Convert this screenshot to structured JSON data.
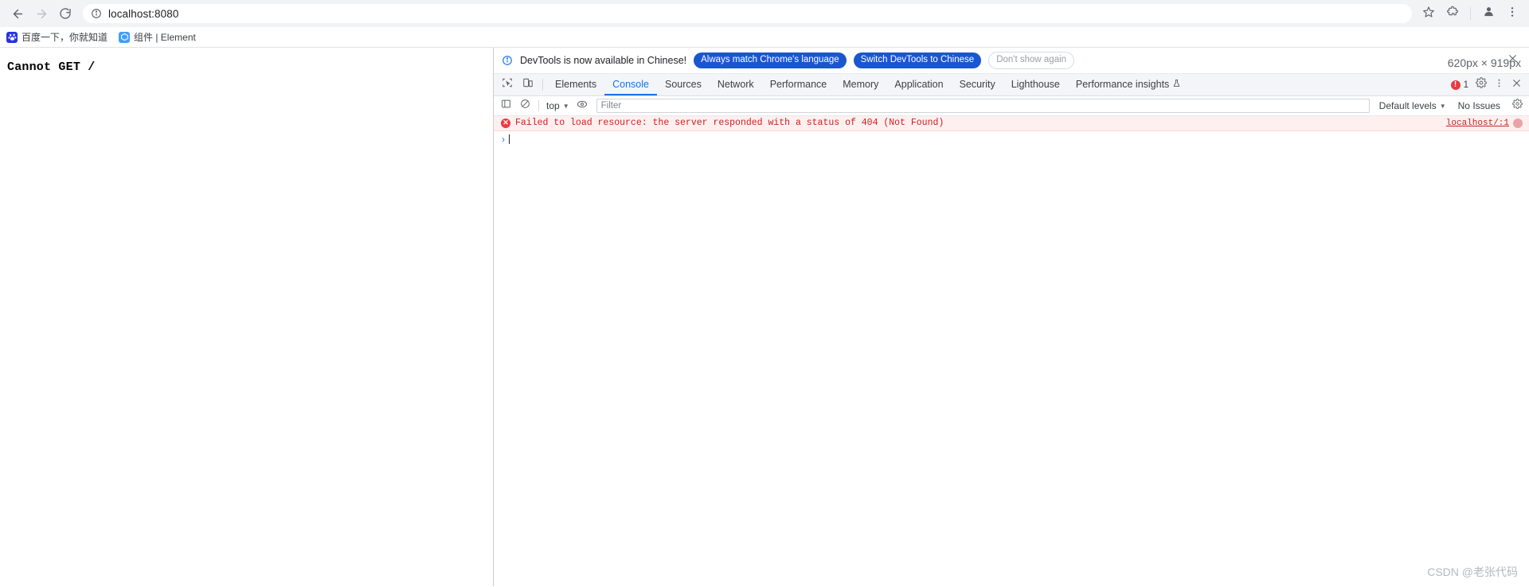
{
  "browser": {
    "back_icon": "arrow-left-icon",
    "forward_icon": "arrow-right-icon",
    "reload_icon": "reload-icon",
    "site_info_icon": "info-circle-icon",
    "url": "localhost:8080",
    "bookmark_star_icon": "star-icon",
    "extensions_icon": "extensions-puzzle-icon",
    "profile_icon": "profile-avatar-icon",
    "menu_icon": "three-dot-menu-icon"
  },
  "bookmarks": [
    {
      "label": "百度一下，你就知道",
      "favicon": "baidu-favicon",
      "glyph": "熊"
    },
    {
      "label": "组件 | Element",
      "favicon": "element-favicon",
      "glyph": "E"
    }
  ],
  "page": {
    "body_text": "Cannot GET /",
    "viewport_size_label": "620px × 919px"
  },
  "devtools": {
    "notice": {
      "info_icon": "info-circle-icon",
      "message": "DevTools is now available in Chinese!",
      "primary_button": "Always match Chrome's language",
      "secondary_button": "Switch DevTools to Chinese",
      "dismiss_button": "Don't show again",
      "close_icon": "close-x-icon"
    },
    "toolbar_icons": {
      "inspect": "inspect-element-icon",
      "device": "device-toolbar-icon"
    },
    "tabs": [
      {
        "label": "Elements",
        "active": false
      },
      {
        "label": "Console",
        "active": true
      },
      {
        "label": "Sources",
        "active": false
      },
      {
        "label": "Network",
        "active": false
      },
      {
        "label": "Performance",
        "active": false
      },
      {
        "label": "Memory",
        "active": false
      },
      {
        "label": "Application",
        "active": false
      },
      {
        "label": "Security",
        "active": false
      },
      {
        "label": "Lighthouse",
        "active": false
      },
      {
        "label": "Performance insights",
        "active": false,
        "icon": "flask-beaker-icon"
      }
    ],
    "error_count": "1",
    "settings_icon": "gear-icon",
    "more_icon": "three-dot-menu-icon",
    "close_icon": "close-x-icon",
    "console_toolbar": {
      "sidebar_icon": "console-sidebar-icon",
      "clear_icon": "clear-console-icon",
      "context": "top",
      "eye_icon": "live-expression-eye-icon",
      "filter_placeholder": "Filter",
      "filter_value": "",
      "levels": "Default levels",
      "issues_status": "No Issues",
      "settings_icon": "gear-icon"
    },
    "console_messages": [
      {
        "level": "error",
        "icon": "error-circle-icon",
        "text": "Failed to load resource: the server responded with a status of 404 (Not Found)",
        "source": "localhost/:1",
        "badge": "?"
      }
    ],
    "prompt": {
      "arrow": "›"
    }
  },
  "watermark": "CSDN @老张代码",
  "colors": {
    "accent": "#1a73e8",
    "error": "#eb3941",
    "error_bg": "#fff0f0",
    "toolbar_bg": "#f1f3f4",
    "tabbar_bg": "#f3f5f9",
    "pill_primary": "#1a56cf"
  }
}
